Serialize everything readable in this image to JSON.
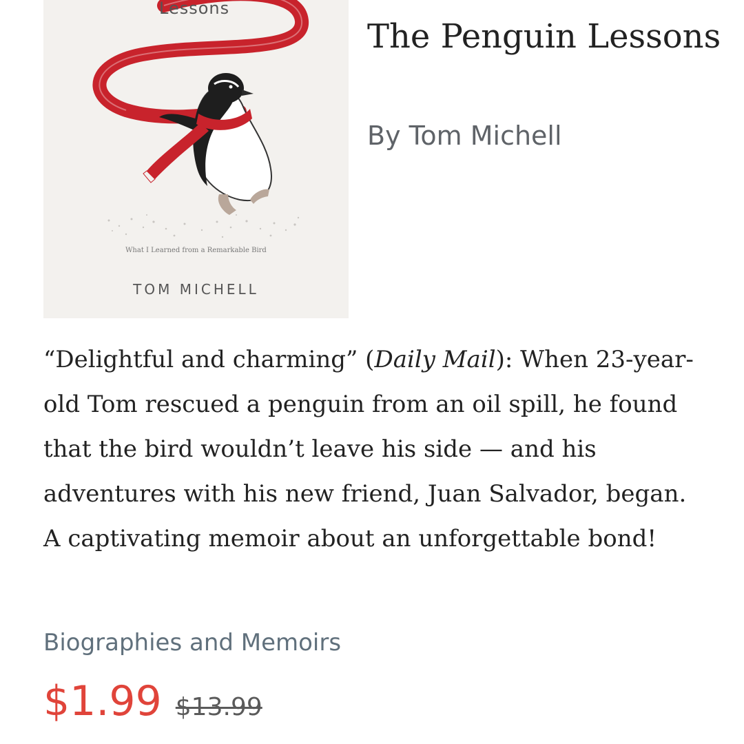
{
  "book": {
    "cover": {
      "title_fragment": "Lessons",
      "subtitle": "What I Learned from a Remarkable Bird",
      "author": "TOM MICHELL",
      "scarf_color": "#c8232c"
    },
    "title": "The Penguin Lessons",
    "author_line": "By Tom Michell",
    "description": {
      "quote": "“Delightful and charming”",
      "source_open": " (",
      "source": "Daily Mail",
      "source_close": ")",
      "body": ": When 23-year-old Tom rescued a penguin from an oil spill, he found that the bird wouldn’t leave his side — and his adventures with his new friend, Juan Salvador, began. A captivating memoir about an unforgettable bond!"
    },
    "category": "Biographies and Memoirs",
    "price": {
      "current": "$1.99",
      "original": "$13.99",
      "current_color": "#e0443a"
    }
  }
}
